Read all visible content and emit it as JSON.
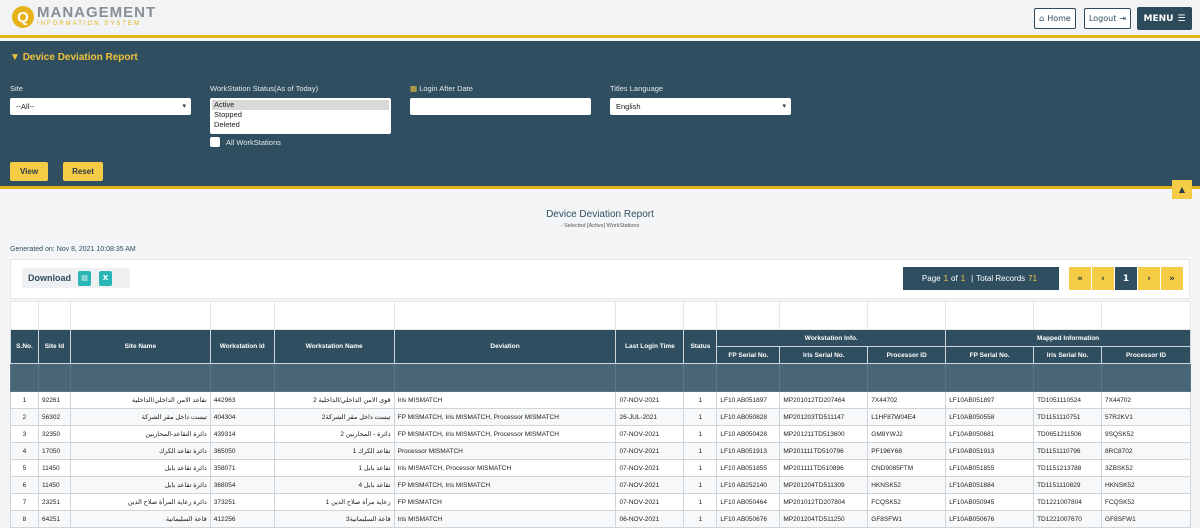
{
  "header": {
    "logo_main": "MANAGEMENT",
    "logo_sub": "INFORMATION SYSTEM",
    "logo_letter": "Q",
    "home_label": "Home",
    "logout_label": "Logout",
    "menu_label": "MENU"
  },
  "filters": {
    "title": "Device Deviation Report",
    "site_label": "Site",
    "site_value": "--All--",
    "status_label": "WorkStation Status(As of Today)",
    "status_options": [
      "Active",
      "Stopped",
      "Deleted"
    ],
    "login_label": "Login After Date",
    "login_value": "",
    "lang_label": "Titles Language",
    "lang_value": "English",
    "all_ws_label": "All WorkStations",
    "view_label": "View",
    "reset_label": "Reset"
  },
  "report": {
    "title": "Device Deviation Report",
    "subtitle": "- Selected [Active] WorkStations",
    "generated": "Generated on: Nov 8, 2021 10:08:35 AM",
    "download_label": "Download",
    "page_word": "Page",
    "page_current": "1",
    "of_word": "of",
    "page_total": "1",
    "total_records_label": "Total Records",
    "total_records": "71",
    "pager_first": "«",
    "pager_prev": "‹",
    "pager_page": "1",
    "pager_next": "›",
    "pager_last": "»"
  },
  "table": {
    "columns": [
      "S.No.",
      "Site Id",
      "Site Name",
      "Workstation Id",
      "Workstation Name",
      "Deviation",
      "Last Login Time",
      "Status"
    ],
    "group_ws": "Workstation Info.",
    "group_mapped": "Mapped Information",
    "sub_columns": [
      "FP Serial No.",
      "Iris Serial No.",
      "Processor ID",
      "FP Serial No.",
      "Iris Serial No.",
      "Processor ID"
    ],
    "rows": [
      [
        "1",
        "92261",
        "نقاعد الامن الداخلي/الداخلية",
        "442963",
        "قوى الامن الداخلي/الداخلية 2",
        "Iris MISMATCH",
        "07-NOV-2021",
        "1",
        "LF10 AB051897",
        "MP201012TD207464",
        "7X44702",
        "LF10AB051897",
        "TD1051110524",
        "7X44702"
      ],
      [
        "2",
        "56302",
        "تيست داخل مقر الشركة",
        "404304",
        "تيست داخل مقر الشركة2",
        "FP MISMATCH, Iris MISMATCH, Processor MISMATCH",
        "26-JUL-2021",
        "1",
        "LF10 AB050828",
        "MP201203TD511147",
        "L1HF87W04E4",
        "LF10AB050558",
        "TD1151110751",
        "57R2KV1"
      ],
      [
        "3",
        "32350",
        "دائرة التقاعد-المحاربين",
        "439314",
        "دائرة - المحاربين 2",
        "FP MISMATCH, Iris MISMATCH, Processor MISMATCH",
        "07-NOV-2021",
        "1",
        "LF10 AB050428",
        "MP201211TD513600",
        "GM8YWJ2",
        "LF10AB050681",
        "TD0651211506",
        "9SQSK52"
      ],
      [
        "4",
        "17050",
        "دائرة تقاعد الكرك",
        "365050",
        "تقاعد الكرك 1",
        "Processor MISMATCH",
        "07-NOV-2021",
        "1",
        "LF10 AB051913",
        "MP201111TD510796",
        "PF196Y68",
        "LF10AB051913",
        "TD1151110796",
        "8RC8702"
      ],
      [
        "5",
        "11450",
        "دائرة تقاعد بابل",
        "358071",
        "تقاعد بابل 1",
        "Iris MISMATCH, Processor MISMATCH",
        "07-NOV-2021",
        "1",
        "LF10 AB051855",
        "MP201111TD510896",
        "CND9085FTM",
        "LF10AB051855",
        "TD1151213788",
        "3ZBSK52"
      ],
      [
        "6",
        "11450",
        "دائرة تقاعد بابل",
        "368054",
        "تقاعد بابل 4",
        "FP MISMATCH, Iris MISMATCH",
        "07-NOV-2021",
        "1",
        "LF10 AB252140",
        "MP201204TD511309",
        "HKNSK52",
        "LF10AB051884",
        "TD1151110829",
        "HKNSK52"
      ],
      [
        "7",
        "23251",
        "دائرة رعاية المرأة صلاح الدين",
        "373251",
        "رعاية مرأة صلاح الدين 1",
        "FP MISMATCH",
        "07-NOV-2021",
        "1",
        "LF10 AB050464",
        "MP201012TD207804",
        "FCQSK52",
        "LF10AB050945",
        "TD1221007804",
        "FCQSK52"
      ],
      [
        "8",
        "64251",
        "قاعة السليمانية",
        "412256",
        "قاعة السليمانية3",
        "Iris MISMATCH",
        "06-NOV-2021",
        "1",
        "LF10 AB050676",
        "MP201204TD511250",
        "GF8SFW1",
        "LF10AB050676",
        "TD1221007670",
        "GF8SFW1"
      ]
    ]
  }
}
